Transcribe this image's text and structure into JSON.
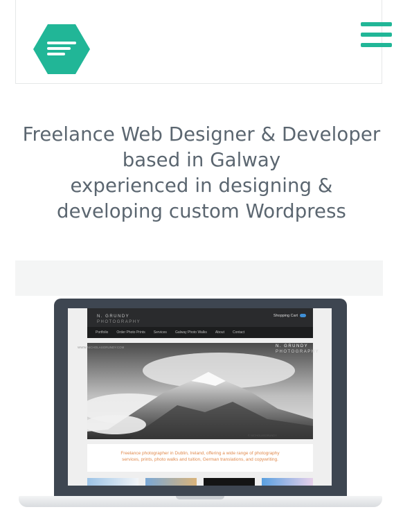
{
  "header": {
    "logo_icon": "hexagon-logo-icon",
    "menu_icon": "hamburger-menu-icon",
    "accent_color": "#21b697"
  },
  "hero": {
    "lines": [
      "Freelance Web Designer & Developer",
      "based in Galway",
      "experienced in designing &",
      "developing custom Wordpress"
    ]
  },
  "showcase": {
    "device_icon": "laptop-icon",
    "site": {
      "brand_line1": "N.   GRUNDY",
      "brand_line2": "PHOTOGRAPHY",
      "cart_label": "Shopping Cart",
      "nav": [
        "Portfolio",
        "Order Photo Prints",
        "Services",
        "Galway Photo Walks",
        "About",
        "Contact"
      ],
      "url": "WWW.NICHOLASGRUNDY.COM",
      "hero_brand_line1": "N.   GRUNDY",
      "hero_brand_line2": "PHOTOGRAPHY",
      "hero_credit": "© NICHOLASGRUNDY",
      "tagline_line1": "Freelance photographer in Dublin, Ireland, offering a wide range of photography",
      "tagline_line2": "services, prints, photo walks and tuition, German translations, and copywriting."
    }
  }
}
